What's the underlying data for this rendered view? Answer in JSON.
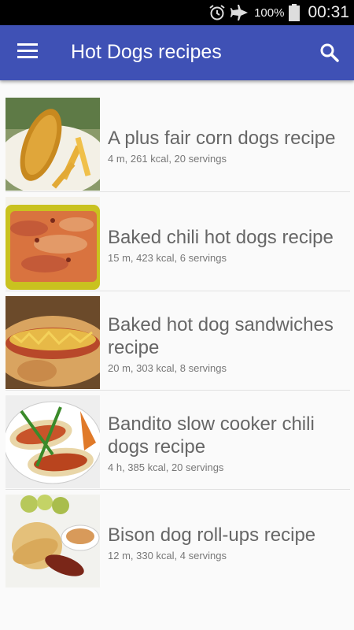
{
  "status_bar": {
    "battery": "100%",
    "time": "00:31",
    "icons": [
      "alarm-icon",
      "airplane-icon",
      "battery-icon"
    ]
  },
  "app_bar": {
    "title": "Hot Dogs recipes",
    "menu_icon": "menu-icon",
    "search_icon": "search-icon",
    "color": "#3f51b5"
  },
  "recipes": [
    {
      "title": "A plus fair corn dogs recipe",
      "meta": "4 m, 261 kcal, 20 servings"
    },
    {
      "title": "Baked chili hot dogs recipe",
      "meta": "15 m, 423 kcal, 6 servings"
    },
    {
      "title": "Baked hot dog sandwiches recipe",
      "meta": "20 m, 303 kcal, 8 servings"
    },
    {
      "title": "Bandito slow cooker chili dogs  recipe",
      "meta": "4 h, 385 kcal, 20 servings"
    },
    {
      "title": "Bison dog roll-ups recipe",
      "meta": "12 m, 330 kcal, 4 servings"
    }
  ]
}
